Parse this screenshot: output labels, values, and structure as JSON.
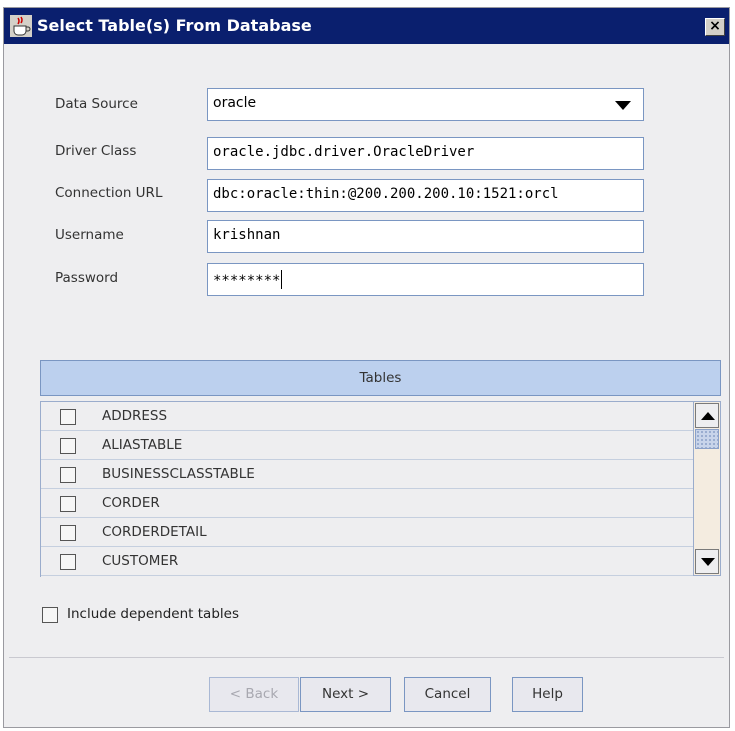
{
  "window": {
    "title": "Select Table(s) From Database",
    "icon": "java-cup-icon",
    "close_label": "×"
  },
  "form": {
    "data_source": {
      "label": "Data Source",
      "value": "oracle"
    },
    "driver_class": {
      "label": "Driver Class",
      "value": "oracle.jdbc.driver.OracleDriver"
    },
    "connection_url": {
      "label": "Connection URL",
      "value": "dbc:oracle:thin:@200.200.200.10:1521:orcl"
    },
    "username": {
      "label": "Username",
      "value": "krishnan"
    },
    "password": {
      "label": "Password",
      "value": "********"
    }
  },
  "tables": {
    "header": "Tables",
    "items": [
      {
        "name": "ADDRESS",
        "checked": false
      },
      {
        "name": "ALIASTABLE",
        "checked": false
      },
      {
        "name": "BUSINESSCLASSTABLE",
        "checked": false
      },
      {
        "name": "CORDER",
        "checked": false
      },
      {
        "name": "CORDERDETAIL",
        "checked": false
      },
      {
        "name": "CUSTOMER",
        "checked": false
      }
    ]
  },
  "options": {
    "include_dependent": {
      "label": "Include dependent tables",
      "checked": false
    }
  },
  "buttons": {
    "back": "< Back",
    "next": "Next >",
    "cancel": "Cancel",
    "help": "Help"
  }
}
